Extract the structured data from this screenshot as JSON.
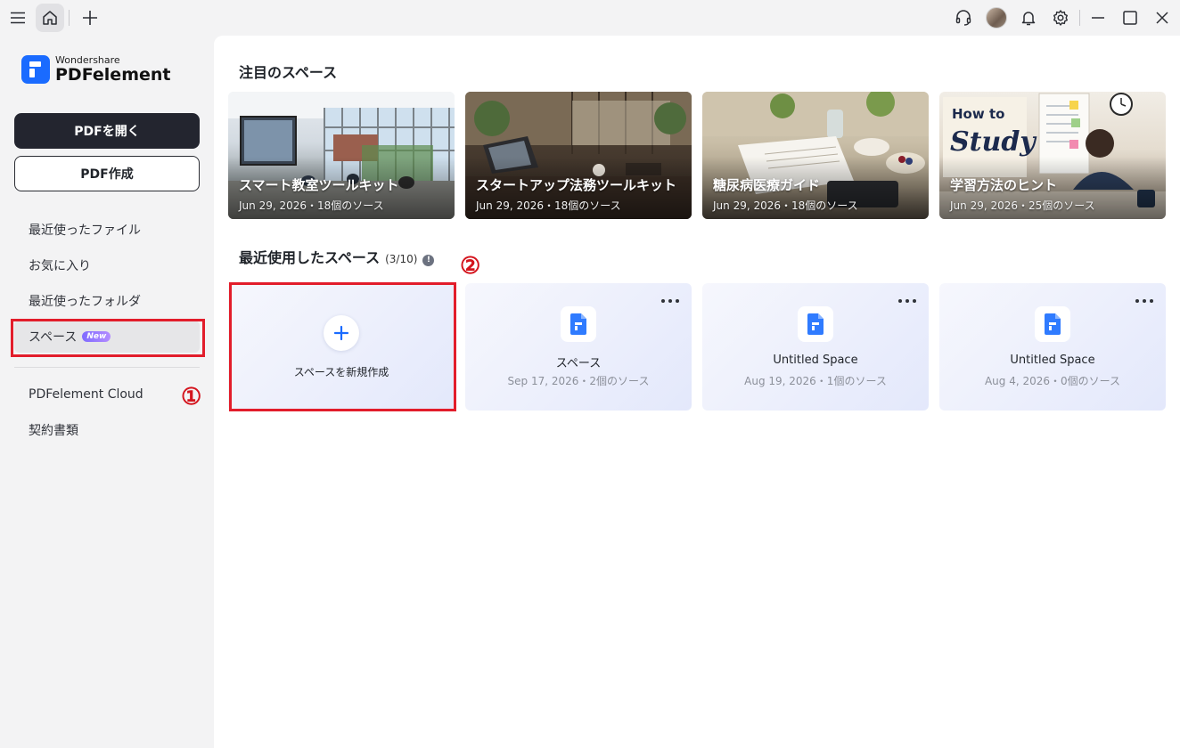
{
  "titlebar": {
    "menu_icon": "menu-icon",
    "home_icon": "home-icon",
    "new_tab_icon": "plus-icon",
    "support_icon": "headset-icon",
    "notification_icon": "bell-icon",
    "settings_icon": "gear-icon",
    "minimize_icon": "minimize-icon",
    "maximize_icon": "maximize-icon",
    "close_icon": "close-icon"
  },
  "logo": {
    "brand": "Wondershare",
    "product": "PDFelement"
  },
  "sidebar": {
    "open_pdf": "PDFを開く",
    "create_pdf": "PDF作成",
    "items": [
      {
        "label": "最近使ったファイル"
      },
      {
        "label": "お気に入り"
      },
      {
        "label": "最近使ったフォルダ"
      },
      {
        "label": "スペース",
        "badge": "New"
      }
    ],
    "items2": [
      {
        "label": "PDFelement Cloud"
      },
      {
        "label": "契約書類"
      }
    ]
  },
  "annotations": {
    "one": "①",
    "two": "②"
  },
  "featured": {
    "title": "注目のスペース",
    "cards": [
      {
        "title": "スマート教室ツールキット",
        "meta": "Jun 29, 2026・18個のソース"
      },
      {
        "title": "スタートアップ法務ツールキット",
        "meta": "Jun 29, 2026・18個のソース"
      },
      {
        "title": "糖尿病医療ガイド",
        "meta": "Jun 29, 2026・18個のソース"
      },
      {
        "title": "学習方法のヒント",
        "meta": "Jun 29, 2026・25個のソース"
      }
    ],
    "study_poster": {
      "line1": "How to",
      "line2": "Study"
    }
  },
  "recent": {
    "title": "最近使用したスペース",
    "count": "(3/10)",
    "info": "!",
    "new_label": "スペースを新規作成",
    "spaces": [
      {
        "name": "スペース",
        "meta": "Sep 17, 2026・2個のソース"
      },
      {
        "name": "Untitled Space",
        "meta": "Aug 19, 2026・1個のソース"
      },
      {
        "name": "Untitled Space",
        "meta": "Aug 4, 2026・0個のソース"
      }
    ]
  },
  "colors": {
    "accent": "#1a6bff",
    "dark_button": "#23252f",
    "annotation_red": "#e21d2b"
  }
}
